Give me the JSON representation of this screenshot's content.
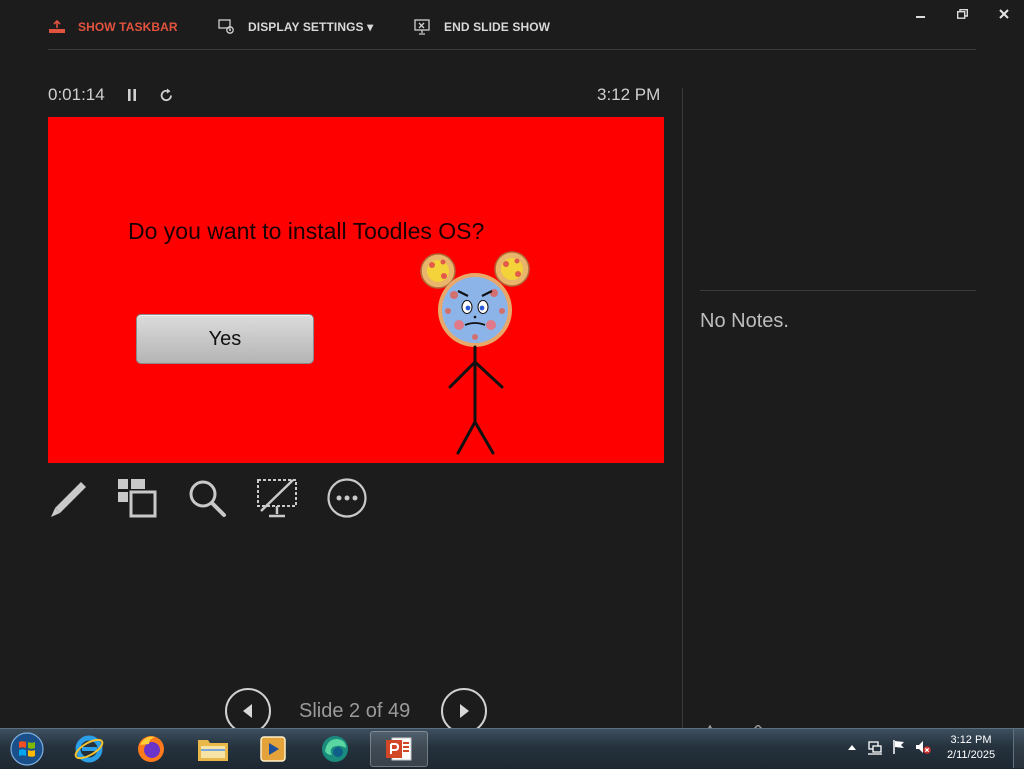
{
  "toolbar": {
    "show_taskbar": "SHOW TASKBAR",
    "display_settings": "DISPLAY SETTINGS ▾",
    "end_slide_show": "END SLIDE SHOW",
    "accent_color": "#e2533f"
  },
  "window_controls": {
    "minimize": "minimize-icon",
    "restore": "restore-icon",
    "close": "close-icon"
  },
  "presenter": {
    "elapsed_time": "0:01:14",
    "clock": "3:12 PM",
    "slide": {
      "question": "Do you want to install Toodles OS?",
      "button_label": "Yes",
      "background_color": "#ff0000"
    },
    "tools": [
      "pen-icon",
      "see-all-slides-icon",
      "zoom-icon",
      "black-screen-icon",
      "more-options-icon"
    ],
    "slide_counter": "Slide 2 of 49"
  },
  "notes": {
    "text": "No Notes."
  },
  "taskbar": {
    "apps": [
      "start-orb-icon",
      "internet-explorer-icon",
      "firefox-icon",
      "file-explorer-icon",
      "media-player-icon",
      "edge-icon",
      "powerpoint-icon"
    ],
    "tray_time": "3:12 PM",
    "tray_date": "2/11/2025"
  }
}
